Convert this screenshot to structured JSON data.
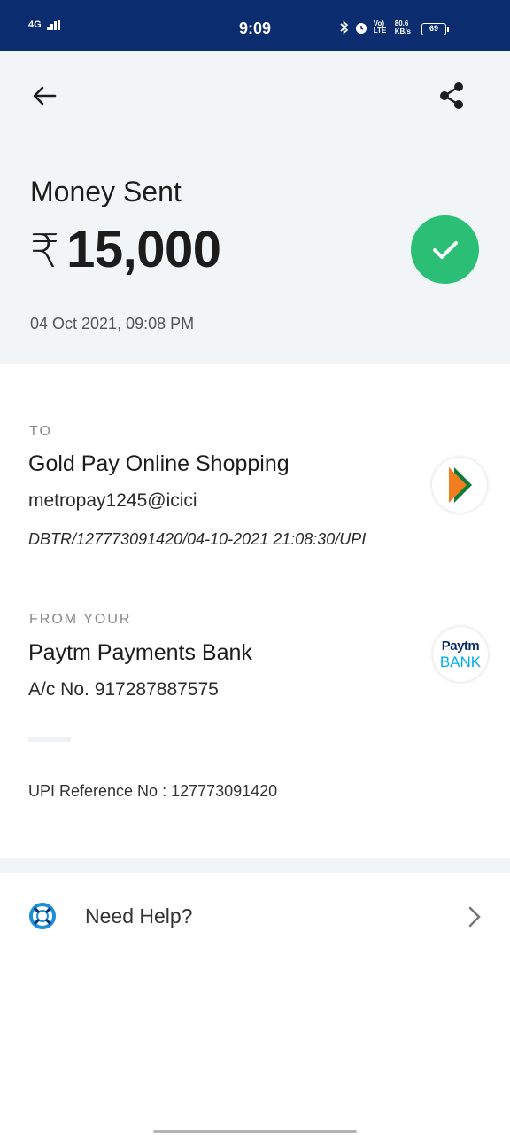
{
  "status_bar": {
    "network_left": "4G",
    "time": "9:09",
    "speed": "80.6",
    "speed_unit": "KB/s",
    "lte": "Vo) LTE",
    "battery": "69"
  },
  "header": {
    "back_icon": "arrow-left-icon",
    "share_icon": "share-icon"
  },
  "hero": {
    "title": "Money Sent",
    "currency_symbol": "₹",
    "amount": "15,000",
    "date": "04 Oct 2021, 09:08 PM",
    "status_icon": "check-icon",
    "status_color": "#2bbf76"
  },
  "to": {
    "label": "TO",
    "name": "Gold Pay Online Shopping",
    "upi_id": "metropay1245@icici",
    "reference_line": "DBTR/127773091420/04-10-2021 21:08:30/UPI",
    "logo": "upi-logo"
  },
  "from": {
    "label": "FROM YOUR",
    "bank": "Paytm Payments Bank",
    "account": "A/c No. 917287887575",
    "logo_line1": "Paytm",
    "logo_line2": "BANK"
  },
  "upi_ref": "UPI Reference No : 127773091420",
  "help": {
    "label": "Need Help?",
    "icon": "lifebuoy-icon",
    "chevron": "chevron-right-icon"
  }
}
